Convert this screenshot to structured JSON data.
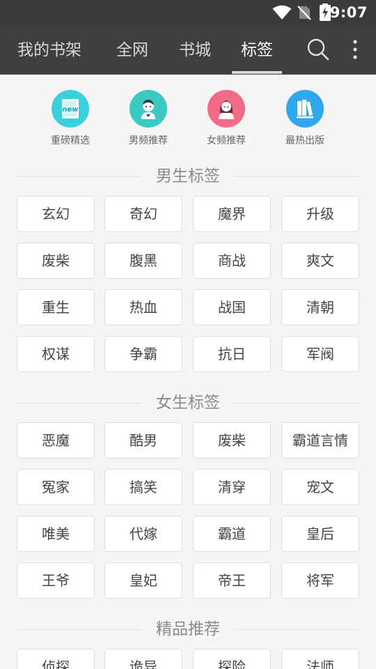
{
  "status_bar": {
    "time": "9:07",
    "icons": [
      "wifi-icon",
      "no-sim-icon",
      "battery-charging-icon"
    ]
  },
  "tabs": [
    {
      "label": "我的书架",
      "active": false
    },
    {
      "label": "全网",
      "active": false
    },
    {
      "label": "书城",
      "active": false
    },
    {
      "label": "标签",
      "active": true
    }
  ],
  "toolbar_icons": [
    "search-icon",
    "more-vert-icon"
  ],
  "categories": [
    {
      "label": "重磅精选",
      "icon": "new-book-icon",
      "color": "#3ccfdc",
      "badge": "new"
    },
    {
      "label": "男频推荐",
      "icon": "boy-icon",
      "color": "#3cc9c4"
    },
    {
      "label": "女频推荐",
      "icon": "girl-icon",
      "color": "#f26b86"
    },
    {
      "label": "最热出版",
      "icon": "books-icon",
      "color": "#2fa7ea"
    }
  ],
  "sections": [
    {
      "title": "男生标签",
      "tags": [
        "玄幻",
        "奇幻",
        "魔界",
        "升级",
        "废柴",
        "腹黑",
        "商战",
        "爽文",
        "重生",
        "热血",
        "战国",
        "清朝",
        "权谋",
        "争霸",
        "抗日",
        "军阀"
      ]
    },
    {
      "title": "女生标签",
      "tags": [
        "恶魔",
        "酷男",
        "废柴",
        "霸道言情",
        "冤家",
        "搞笑",
        "清穿",
        "宠文",
        "唯美",
        "代嫁",
        "霸道",
        "皇后",
        "王爷",
        "皇妃",
        "帝王",
        "将军"
      ]
    },
    {
      "title": "精品推荐",
      "tags": [
        "侦探",
        "诡异",
        "探险",
        "法师"
      ]
    }
  ]
}
